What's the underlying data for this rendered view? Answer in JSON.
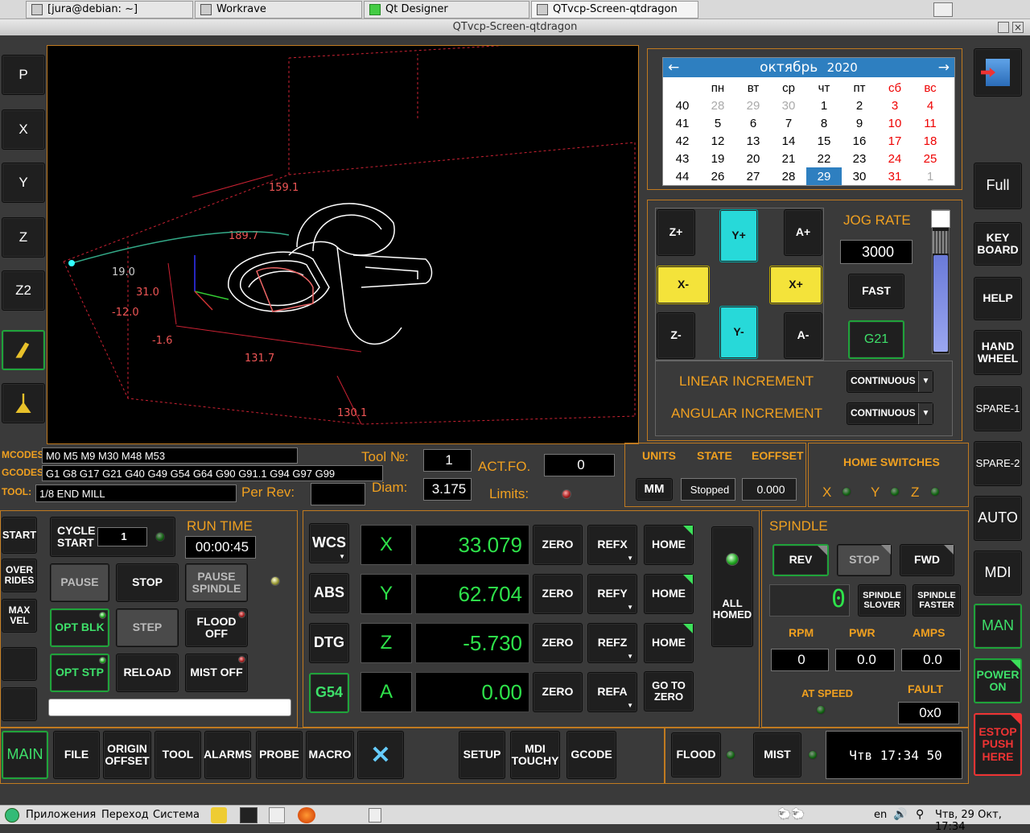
{
  "window_tabs": [
    {
      "label": "[jura@debian: ~]"
    },
    {
      "label": "Workrave"
    },
    {
      "label": "Qt Designer"
    },
    {
      "label": "QTvcp-Screen-qtdragon"
    }
  ],
  "window_title": "QTvcp-Screen-qtdragon",
  "left_buttons": [
    "P",
    "X",
    "Y",
    "Z",
    "Z2"
  ],
  "plot": {
    "dims": [
      "159.1",
      "189.7",
      "19.0",
      "31.0",
      "-12.0",
      "-1.6",
      "131.7",
      "130.1"
    ]
  },
  "calendar": {
    "month": "октябрь",
    "year": "2020",
    "weekdays": [
      "пн",
      "вт",
      "ср",
      "чт",
      "пт",
      "сб",
      "вс"
    ],
    "weeks": [
      {
        "n": "40",
        "days": [
          "28",
          "29",
          "30",
          "1",
          "2",
          "3",
          "4"
        ]
      },
      {
        "n": "41",
        "days": [
          "5",
          "6",
          "7",
          "8",
          "9",
          "10",
          "11"
        ]
      },
      {
        "n": "42",
        "days": [
          "12",
          "13",
          "14",
          "15",
          "16",
          "17",
          "18"
        ]
      },
      {
        "n": "43",
        "days": [
          "19",
          "20",
          "21",
          "22",
          "23",
          "24",
          "25"
        ]
      },
      {
        "n": "44",
        "days": [
          "26",
          "27",
          "28",
          "29",
          "30",
          "31",
          "1"
        ]
      }
    ],
    "selected": "29"
  },
  "jog": {
    "zplus": "Z+",
    "yplus": "Y+",
    "aplus": "A+",
    "xminus": "X-",
    "xplus": "X+",
    "zminus": "Z-",
    "yminus": "Y-",
    "aminus": "A-",
    "rate_label": "JOG RATE",
    "rate": "3000",
    "fast": "FAST",
    "g21": "G21",
    "linear_label": "LINEAR INCREMENT",
    "angular_label": "ANGULAR INCREMENT",
    "linear_value": "CONTINUOUS",
    "angular_value": "CONTINUOUS"
  },
  "right_buttons": {
    "full": "Full",
    "keyboard": "KEY BOARD",
    "help": "HELP",
    "handwheel": "HAND WHEEL",
    "spare1": "SPARE-1",
    "spare2": "SPARE-2",
    "auto": "AUTO",
    "mdi": "MDI",
    "man": "MAN",
    "power": "POWER ON",
    "estop": "ESTOP PUSH HERE"
  },
  "info": {
    "mcodes_label": "MCODES:",
    "mcodes": "M0 M5 M9 M30 M48 M53",
    "gcodes_label": "GCODES:",
    "gcodes": "G1 G8 G17 G21 G40 G49 G54 G64 G90 G91.1 G94 G97 G99",
    "tool_label": "TOOL:",
    "tool": "1/8 END MILL",
    "tool_no_label": "Tool №:",
    "tool_no": "1",
    "act_fo_label": "ACT.FO.",
    "act_fo": "0",
    "per_rev_label": "Per Rev:",
    "diam_label": "Diam:",
    "diam": "3.175",
    "limits_label": "Limits:"
  },
  "status": {
    "units_label": "UNITS",
    "state_label": "STATE",
    "eoffset_label": "EOFFSET",
    "units": "MM",
    "state": "Stopped",
    "eoffset": "0.000",
    "home_label": "HOME SWITCHES",
    "hx": "X",
    "hy": "Y",
    "hz": "Z"
  },
  "program": {
    "start": "START",
    "overrides": "OVER RIDES",
    "maxvel": "MAX VEL",
    "cycle_start": "CYCLE START",
    "cycle_count": "1",
    "run_time_label": "RUN TIME",
    "run_time": "00:00:45",
    "pause": "PAUSE",
    "stop": "STOP",
    "pause_spindle": "PAUSE SPINDLE",
    "opt_blk": "OPT BLK",
    "step": "STEP",
    "flood_off": "FLOOD OFF",
    "opt_stp": "OPT STP",
    "reload": "RELOAD",
    "mist_off": "MIST OFF"
  },
  "dro": {
    "wcs": "WCS",
    "abs": "ABS",
    "dtg": "DTG",
    "g54": "G54",
    "zero": "ZERO",
    "home": "HOME",
    "all_homed": "ALL HOMED",
    "goto_zero": "GO TO ZERO",
    "axes": [
      {
        "name": "X",
        "value": "33.079",
        "ref": "REFX"
      },
      {
        "name": "Y",
        "value": "62.704",
        "ref": "REFY"
      },
      {
        "name": "Z",
        "value": "-5.730",
        "ref": "REFZ"
      },
      {
        "name": "A",
        "value": "0.00",
        "ref": "REFA"
      }
    ]
  },
  "spindle": {
    "title": "SPINDLE",
    "rev": "REV",
    "stop": "STOP",
    "fwd": "FWD",
    "speed": "0",
    "slower": "SPINDLE SLOVER",
    "faster": "SPINDLE FASTER",
    "rpm_label": "RPM",
    "pwr_label": "PWR",
    "amps_label": "AMPS",
    "rpm": "0",
    "pwr": "0.0",
    "amps": "0.0",
    "atspeed_label": "AT SPEED",
    "fault_label": "FAULT",
    "fault": "0x0"
  },
  "bottom": {
    "main": "MAIN",
    "file": "FILE",
    "origin_offset": "ORIGIN OFFSET",
    "tool": "TOOL",
    "alarms": "ALARMS",
    "probe": "PROBE",
    "macro": "MACRO",
    "setup": "SETUP",
    "mdi_touchy": "MDI TOUCHY",
    "gcode": "GCODE",
    "flood": "FLOOD",
    "mist": "MIST",
    "clock": "Чтв  17:34  50"
  },
  "taskbar": {
    "apps": "Приложения",
    "goto": "Переход",
    "system": "Система",
    "lang": "en",
    "datetime": "Чтв, 29 Окт, 17:34"
  }
}
